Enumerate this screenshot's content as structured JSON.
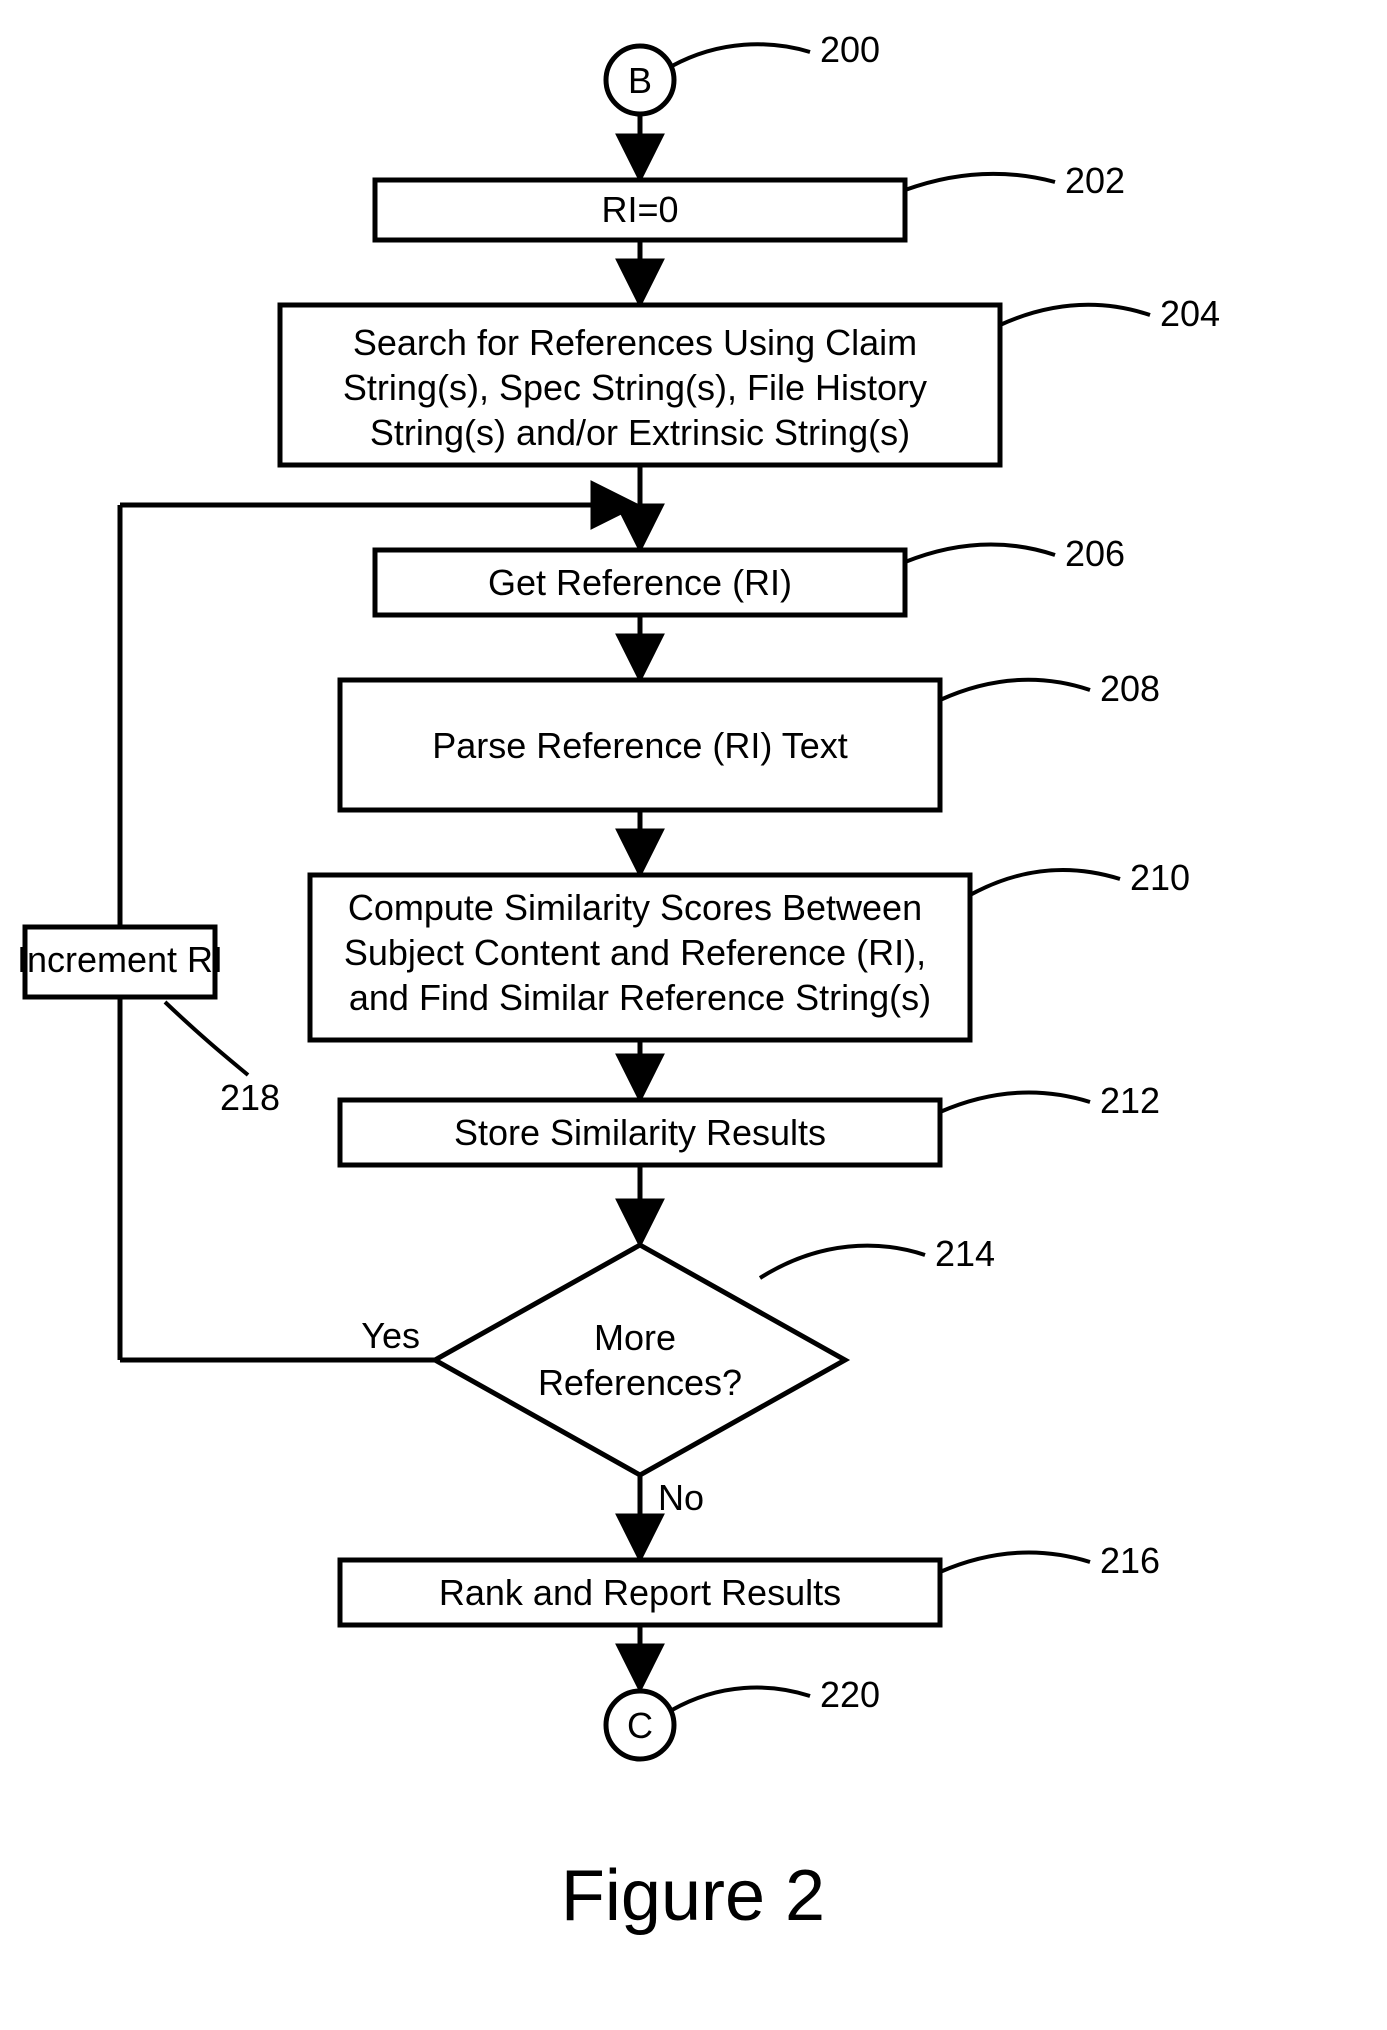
{
  "figure_label": "Figure 2",
  "connectors": {
    "start": "B",
    "end": "C"
  },
  "nodes": {
    "n202": "RI=0",
    "n204": "Search for References Using Claim String(s), Spec String(s), File History String(s) and/or Extrinsic String(s)",
    "n206": "Get Reference (RI)",
    "n208": "Parse Reference (RI) Text",
    "n210": "Compute Similarity Scores Between Subject Content and Reference (RI), and Find Similar Reference String(s)",
    "n212": "Store Similarity Results",
    "n214": "More References?",
    "n216": "Rank and Report Results",
    "n218": "Increment RI"
  },
  "branch_labels": {
    "yes": "Yes",
    "no": "No"
  },
  "ref_labels": {
    "r200": "200",
    "r202": "202",
    "r204": "204",
    "r206": "206",
    "r208": "208",
    "r210": "210",
    "r212": "212",
    "r214": "214",
    "r216": "216",
    "r218": "218",
    "r220": "220"
  },
  "chart_data": {
    "type": "flowchart",
    "title": "Figure 2",
    "nodes": [
      {
        "id": "200",
        "kind": "connector",
        "label": "B"
      },
      {
        "id": "202",
        "kind": "process",
        "label": "RI=0"
      },
      {
        "id": "204",
        "kind": "process",
        "label": "Search for References Using Claim String(s), Spec String(s), File History String(s) and/or Extrinsic String(s)"
      },
      {
        "id": "206",
        "kind": "process",
        "label": "Get Reference (RI)"
      },
      {
        "id": "208",
        "kind": "process",
        "label": "Parse Reference (RI) Text"
      },
      {
        "id": "210",
        "kind": "process",
        "label": "Compute Similarity Scores Between Subject Content and Reference (RI), and Find Similar Reference String(s)"
      },
      {
        "id": "212",
        "kind": "process",
        "label": "Store Similarity Results"
      },
      {
        "id": "214",
        "kind": "decision",
        "label": "More References?"
      },
      {
        "id": "216",
        "kind": "process",
        "label": "Rank and Report Results"
      },
      {
        "id": "218",
        "kind": "process",
        "label": "Increment RI"
      },
      {
        "id": "220",
        "kind": "connector",
        "label": "C"
      }
    ],
    "edges": [
      {
        "from": "200",
        "to": "202"
      },
      {
        "from": "202",
        "to": "204"
      },
      {
        "from": "204",
        "to": "206"
      },
      {
        "from": "206",
        "to": "208"
      },
      {
        "from": "208",
        "to": "210"
      },
      {
        "from": "210",
        "to": "212"
      },
      {
        "from": "212",
        "to": "214"
      },
      {
        "from": "214",
        "to": "218",
        "label": "Yes"
      },
      {
        "from": "218",
        "to": "206"
      },
      {
        "from": "214",
        "to": "216",
        "label": "No"
      },
      {
        "from": "216",
        "to": "220"
      }
    ]
  }
}
